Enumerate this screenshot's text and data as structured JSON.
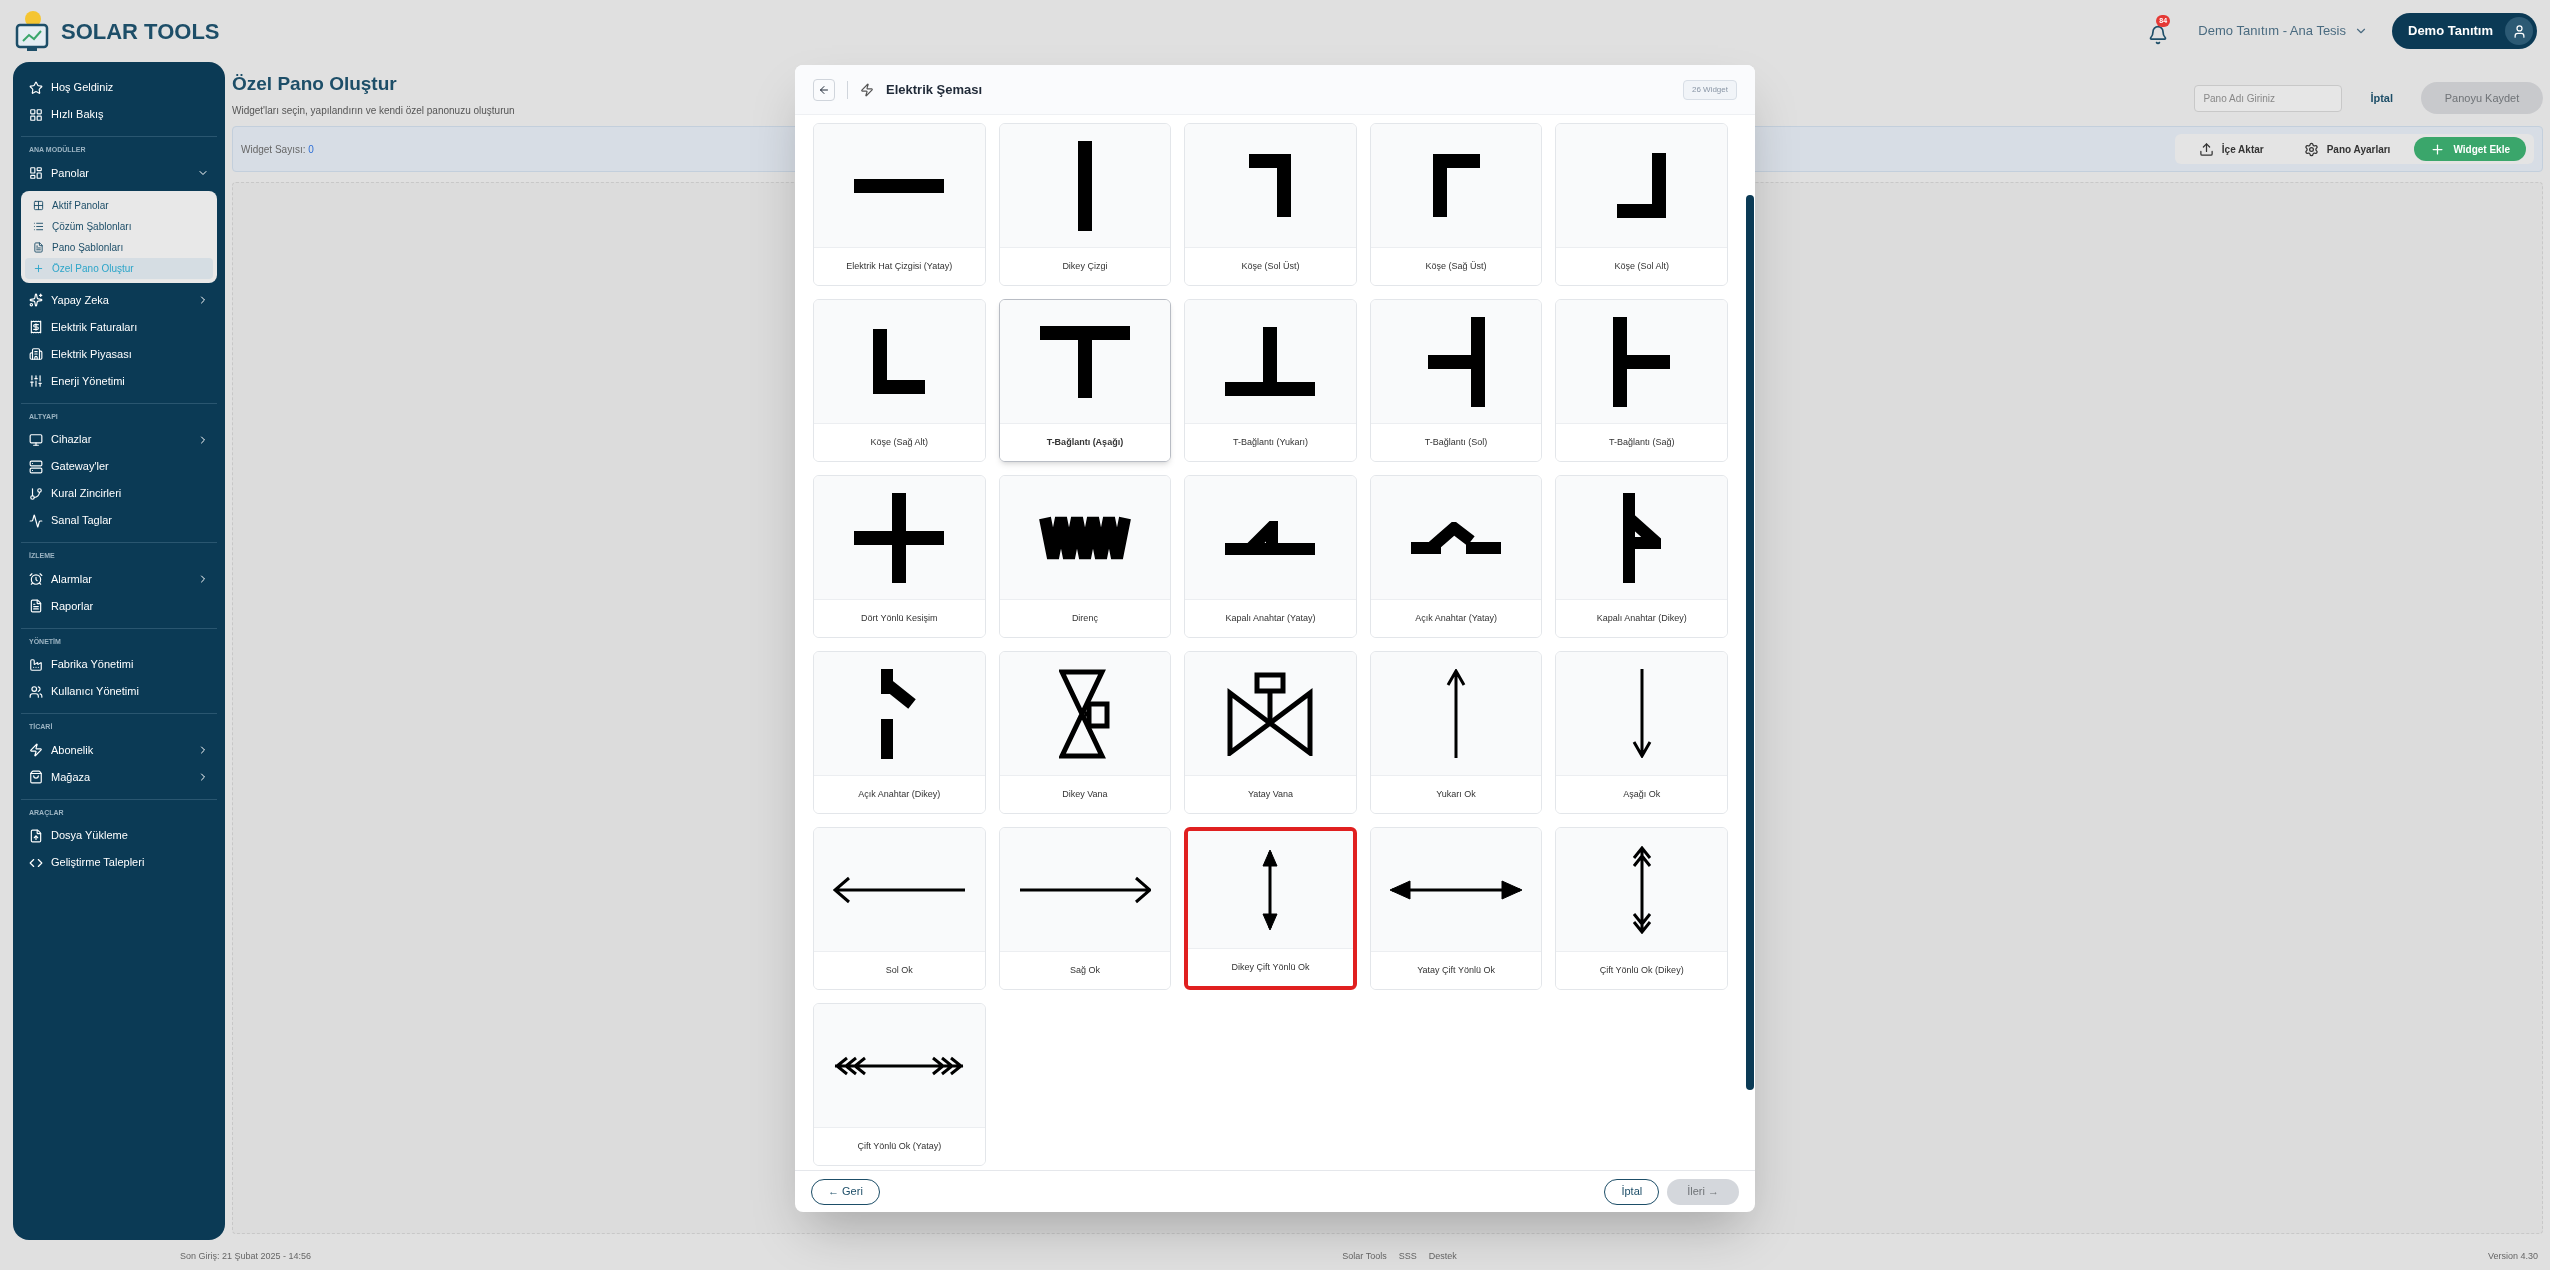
{
  "header": {
    "brand": "SOLAR TOOLS",
    "notification_count": "84",
    "facility": "Demo Tanıtım - Ana Tesis",
    "user": "Demo Tanıtım"
  },
  "sidebar": {
    "sections": [
      {
        "items": [
          {
            "label": "Hoş Geldiniz",
            "kind": "link",
            "selected": false
          },
          {
            "label": "Hızlı Bakış",
            "kind": "link",
            "selected": false
          }
        ]
      },
      {
        "title": "ANA MODÜLLER",
        "items": [
          {
            "label": "Panolar",
            "kind": "group",
            "expanded": true,
            "selected": false,
            "children": [
              {
                "label": "Aktif Panolar",
                "selected": false
              },
              {
                "label": "Çözüm Şablonları",
                "selected": false
              },
              {
                "label": "Pano Şablonları",
                "selected": false
              },
              {
                "label": "Özel Pano Oluştur",
                "selected": true
              }
            ]
          },
          {
            "label": "Yapay Zeka",
            "kind": "group",
            "expanded": false,
            "selected": false
          },
          {
            "label": "Elektrik Faturaları",
            "kind": "link",
            "selected": false
          },
          {
            "label": "Elektrik Piyasası",
            "kind": "link",
            "selected": false
          },
          {
            "label": "Enerji Yönetimi",
            "kind": "link",
            "selected": false
          }
        ]
      },
      {
        "title": "ALTYAPI",
        "items": [
          {
            "label": "Cihazlar",
            "kind": "group",
            "expanded": false,
            "selected": false
          },
          {
            "label": "Gateway'ler",
            "kind": "link",
            "selected": false
          },
          {
            "label": "Kural Zincirleri",
            "kind": "link",
            "selected": false
          },
          {
            "label": "Sanal Taglar",
            "kind": "link",
            "selected": false
          }
        ]
      },
      {
        "title": "İZLEME",
        "items": [
          {
            "label": "Alarmlar",
            "kind": "group",
            "expanded": false,
            "selected": false
          },
          {
            "label": "Raporlar",
            "kind": "link",
            "selected": false
          }
        ]
      },
      {
        "title": "YÖNETİM",
        "items": [
          {
            "label": "Fabrika Yönetimi",
            "kind": "link",
            "selected": false
          },
          {
            "label": "Kullanıcı Yönetimi",
            "kind": "link",
            "selected": false
          }
        ]
      },
      {
        "title": "TİCARİ",
        "items": [
          {
            "label": "Abonelik",
            "kind": "group",
            "expanded": false,
            "selected": false
          },
          {
            "label": "Mağaza",
            "kind": "group",
            "expanded": false,
            "selected": false
          }
        ]
      },
      {
        "title": "ARAÇLAR",
        "items": [
          {
            "label": "Dosya Yükleme",
            "kind": "link",
            "selected": false
          },
          {
            "label": "Geliştirme Talepleri",
            "kind": "link",
            "selected": false
          }
        ]
      }
    ]
  },
  "page": {
    "title": "Özel Pano Oluştur",
    "subtitle": "Widget'ları seçin, yapılandırın ve kendi özel panonuzu oluşturun",
    "name_field": {
      "placeholder": "Pano Adı Giriniz"
    },
    "cancel": "İptal",
    "save": {
      "label": "Panoyu Kaydet",
      "disabled": true
    },
    "toolbar": {
      "count_label": "Widget Sayısı:",
      "count": "0",
      "buttons": [
        {
          "label": "İçe Aktar",
          "kind": "import"
        },
        {
          "label": "Pano Ayarları",
          "kind": "settings"
        },
        {
          "label": "Widget Ekle",
          "kind": "add"
        }
      ]
    }
  },
  "modal": {
    "title": "Elektrik Şeması",
    "badge": "26 Widget",
    "widgets": [
      {
        "label": "Elektrik Hat Çizgisi (Yatay)",
        "kind": "h-line",
        "selected": false,
        "hovered": false
      },
      {
        "label": "Dikey Çizgi",
        "kind": "v-line",
        "selected": false,
        "hovered": false
      },
      {
        "label": "Köşe (Sol Üst)",
        "kind": "corner-tl",
        "selected": false,
        "hovered": false
      },
      {
        "label": "Köşe (Sağ Üst)",
        "kind": "corner-tr",
        "selected": false,
        "hovered": false
      },
      {
        "label": "Köşe (Sol Alt)",
        "kind": "corner-bl",
        "selected": false,
        "hovered": false
      },
      {
        "label": "Köşe (Sağ Alt)",
        "kind": "corner-br",
        "selected": false,
        "hovered": false
      },
      {
        "label": "T-Bağlantı (Aşağı)",
        "kind": "tee-down",
        "selected": false,
        "hovered": true
      },
      {
        "label": "T-Bağlantı (Yukarı)",
        "kind": "tee-up",
        "selected": false,
        "hovered": false
      },
      {
        "label": "T-Bağlantı (Sol)",
        "kind": "tee-left",
        "selected": false,
        "hovered": false
      },
      {
        "label": "T-Bağlantı (Sağ)",
        "kind": "tee-right",
        "selected": false,
        "hovered": false
      },
      {
        "label": "Dört Yönlü Kesişim",
        "kind": "cross",
        "selected": false,
        "hovered": false
      },
      {
        "label": "Direnç",
        "kind": "resistor",
        "selected": false,
        "hovered": false
      },
      {
        "label": "Kapalı Anahtar (Yatay)",
        "kind": "switch-closed-h",
        "selected": false,
        "hovered": false
      },
      {
        "label": "Açık Anahtar (Yatay)",
        "kind": "switch-open-h",
        "selected": false,
        "hovered": false
      },
      {
        "label": "Kapalı Anahtar (Dikey)",
        "kind": "switch-closed-v",
        "selected": false,
        "hovered": false
      },
      {
        "label": "Açık Anahtar (Dikey)",
        "kind": "switch-open-v",
        "selected": false,
        "hovered": false
      },
      {
        "label": "Dikey Vana",
        "kind": "valve-v",
        "selected": false,
        "hovered": false
      },
      {
        "label": "Yatay Vana",
        "kind": "valve-h",
        "selected": false,
        "hovered": false
      },
      {
        "label": "Yukarı Ok",
        "kind": "arrow-up",
        "selected": false,
        "hovered": false
      },
      {
        "label": "Aşağı Ok",
        "kind": "arrow-down",
        "selected": false,
        "hovered": false
      },
      {
        "label": "Sol Ok",
        "kind": "arrow-left",
        "selected": false,
        "hovered": false
      },
      {
        "label": "Sağ Ok",
        "kind": "arrow-right",
        "selected": false,
        "hovered": false
      },
      {
        "label": "Dikey Çift Yönlü Ok",
        "kind": "arrow-v-double",
        "selected": true,
        "hovered": false
      },
      {
        "label": "Yatay Çift Yönlü Ok",
        "kind": "arrow-h-double",
        "selected": false,
        "hovered": false
      },
      {
        "label": "Çift Yönlü Ok (Dikey)",
        "kind": "chevron-v-double",
        "selected": false,
        "hovered": false
      },
      {
        "label": "Çift Yönlü Ok (Yatay)",
        "kind": "chevron-h-double",
        "selected": false,
        "hovered": false
      }
    ],
    "back": "← Geri",
    "cancel": "İptal",
    "next": {
      "label": "İleri →",
      "disabled": true
    }
  },
  "footer": {
    "last_login": "Son Giriş: 21 Şubat 2025 - 14:56",
    "links": [
      "Solar Tools",
      "SSS",
      "Destek"
    ],
    "version": "Version 4.30"
  }
}
